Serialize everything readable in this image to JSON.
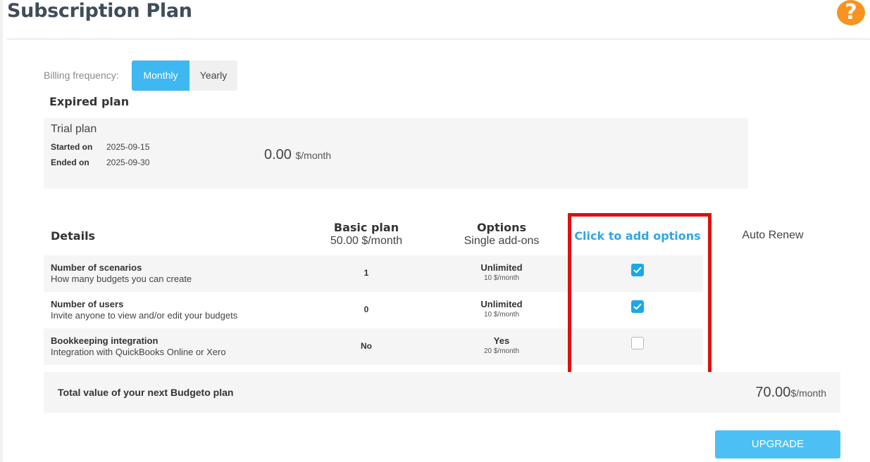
{
  "header": {
    "title": "Subscription Plan",
    "help_icon": "question-mark-icon",
    "help_glyph": "?"
  },
  "billing": {
    "label": "Billing frequency:",
    "options": [
      "Monthly",
      "Yearly"
    ],
    "selected": "Monthly"
  },
  "expired": {
    "heading": "Expired plan",
    "plan_name": "Trial plan",
    "started_label": "Started on",
    "started_value": "2025-09-15",
    "ended_label": "Ended on",
    "ended_value": "2025-09-30",
    "price": "0.00",
    "price_unit": "$/month"
  },
  "table": {
    "details_header": "Details",
    "basic_header": "Basic plan",
    "basic_price": "50.00 $/month",
    "options_header": "Options",
    "options_sub": "Single add-ons",
    "click_header": "Click to add options",
    "auto_renew_header": "Auto Renew",
    "rows": [
      {
        "title": "Number of scenarios",
        "desc": "How many budgets you can create",
        "basic": "1",
        "option": "Unlimited",
        "option_price": "10 $/month",
        "checked": true
      },
      {
        "title": "Number of users",
        "desc": "Invite anyone to view and/or edit your budgets",
        "basic": "0",
        "option": "Unlimited",
        "option_price": "10 $/month",
        "checked": true
      },
      {
        "title": "Bookkeeping integration",
        "desc": "Integration with QuickBooks Online or Xero",
        "basic": "No",
        "option": "Yes",
        "option_price": "20 $/month",
        "checked": false
      }
    ]
  },
  "total": {
    "label": "Total value of your next Budgeto plan",
    "price": "70.00",
    "price_unit": "$/month"
  },
  "actions": {
    "upgrade_label": "UPGRADE"
  },
  "colors": {
    "accent": "#3fb7f0",
    "help": "#f7931e",
    "highlight": "#e01010",
    "link": "#2fa6e6"
  }
}
